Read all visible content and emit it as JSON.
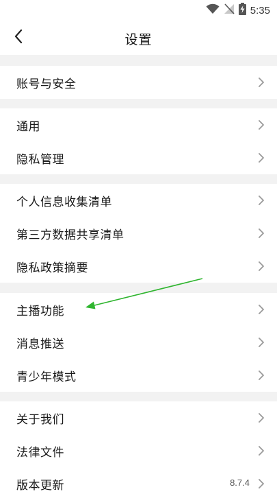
{
  "status_bar": {
    "time": "5:35",
    "icons": [
      "wifi-icon",
      "no-signal-icon",
      "battery-charging-icon"
    ]
  },
  "header": {
    "title": "设置",
    "back_icon": "chevron-left-icon"
  },
  "sections": [
    {
      "items": [
        {
          "label": "账号与安全"
        }
      ]
    },
    {
      "items": [
        {
          "label": "通用"
        },
        {
          "label": "隐私管理"
        }
      ]
    },
    {
      "items": [
        {
          "label": "个人信息收集清单"
        },
        {
          "label": "第三方数据共享清单"
        },
        {
          "label": "隐私政策摘要"
        }
      ]
    },
    {
      "items": [
        {
          "label": "主播功能"
        },
        {
          "label": "消息推送"
        },
        {
          "label": "青少年模式"
        }
      ]
    },
    {
      "items": [
        {
          "label": "关于我们"
        },
        {
          "label": "法律文件"
        },
        {
          "label": "版本更新",
          "value": "8.7.4"
        }
      ]
    }
  ],
  "colors": {
    "background": "#f2f2f2",
    "row": "#ffffff",
    "text": "#1a1a1a",
    "chevron": "#9a9a9a",
    "annotation_arrow": "#2fb52f"
  }
}
